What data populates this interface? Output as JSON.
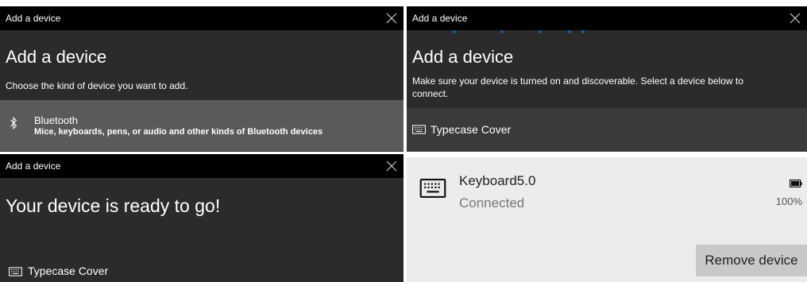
{
  "dialog1": {
    "window_title": "Add a device",
    "heading": "Add a device",
    "subtitle": "Choose the kind of device you want to add.",
    "option": {
      "title": "Bluetooth",
      "description": "Mice, keyboards, pens, or audio and other kinds of Bluetooth devices"
    }
  },
  "dialog2": {
    "window_title": "Add a device",
    "heading": "Add a device",
    "subtitle": "Make sure your device is turned on and discoverable. Select a device below to connect.",
    "device_label": "Typecase Cover"
  },
  "dialog3": {
    "window_title": "Add a device",
    "heading": "Your device is ready to go!",
    "device_label": "Typecase Cover"
  },
  "device_card": {
    "name": "Keyboard5.0",
    "status": "Connected",
    "battery": "100%",
    "remove_label": "Remove device"
  },
  "colors": {
    "titlebar": "#000000",
    "panel": "#2b2b2b",
    "selected_row": "#5a5a5a",
    "accent_dots": "#0078d7",
    "card_bg": "#ececec",
    "button_bg": "#c8c8c8"
  }
}
